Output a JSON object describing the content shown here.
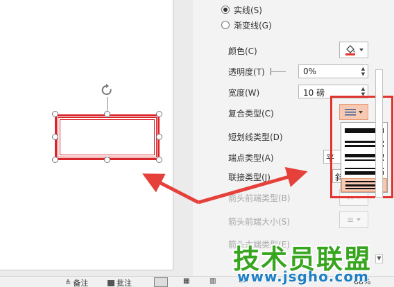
{
  "line_options": {
    "solid_line": "实线(S)",
    "gradient_line": "渐变线(G)"
  },
  "properties": {
    "color_label": "颜色(C)",
    "transparency_label": "透明度(T)",
    "transparency_value": "0%",
    "width_label": "宽度(W)",
    "width_value": "10 磅",
    "compound_label": "复合类型(C)",
    "dash_label": "短划线类型(D)",
    "cap_label": "端点类型(A)",
    "cap_value": "平",
    "join_label": "联接类型(J)",
    "join_value": "斜",
    "arrow_begin_type_label": "箭头前端类型(B)",
    "arrow_begin_size_label": "箭头前端大小(S)",
    "arrow_end_type_label": "箭头末端类型(E)"
  },
  "compound_menu": {
    "options": [
      "single-thick",
      "double",
      "thick-thin",
      "thin-thick",
      "triple"
    ],
    "selected": "triple"
  },
  "status_bar": {
    "notes_label": "备注",
    "comments_label": "批注",
    "zoom": "68%"
  },
  "watermark": {
    "title": "技术员联盟",
    "url": "www.jsgho.com"
  },
  "colors": {
    "shape_outline": "#d9262b",
    "highlight_box": "#e3332f",
    "arrow": "#e5403a",
    "selected_option": "#f7c9b3",
    "watermark_green": "#37a51e",
    "watermark_blue": "#1f7fc2"
  }
}
